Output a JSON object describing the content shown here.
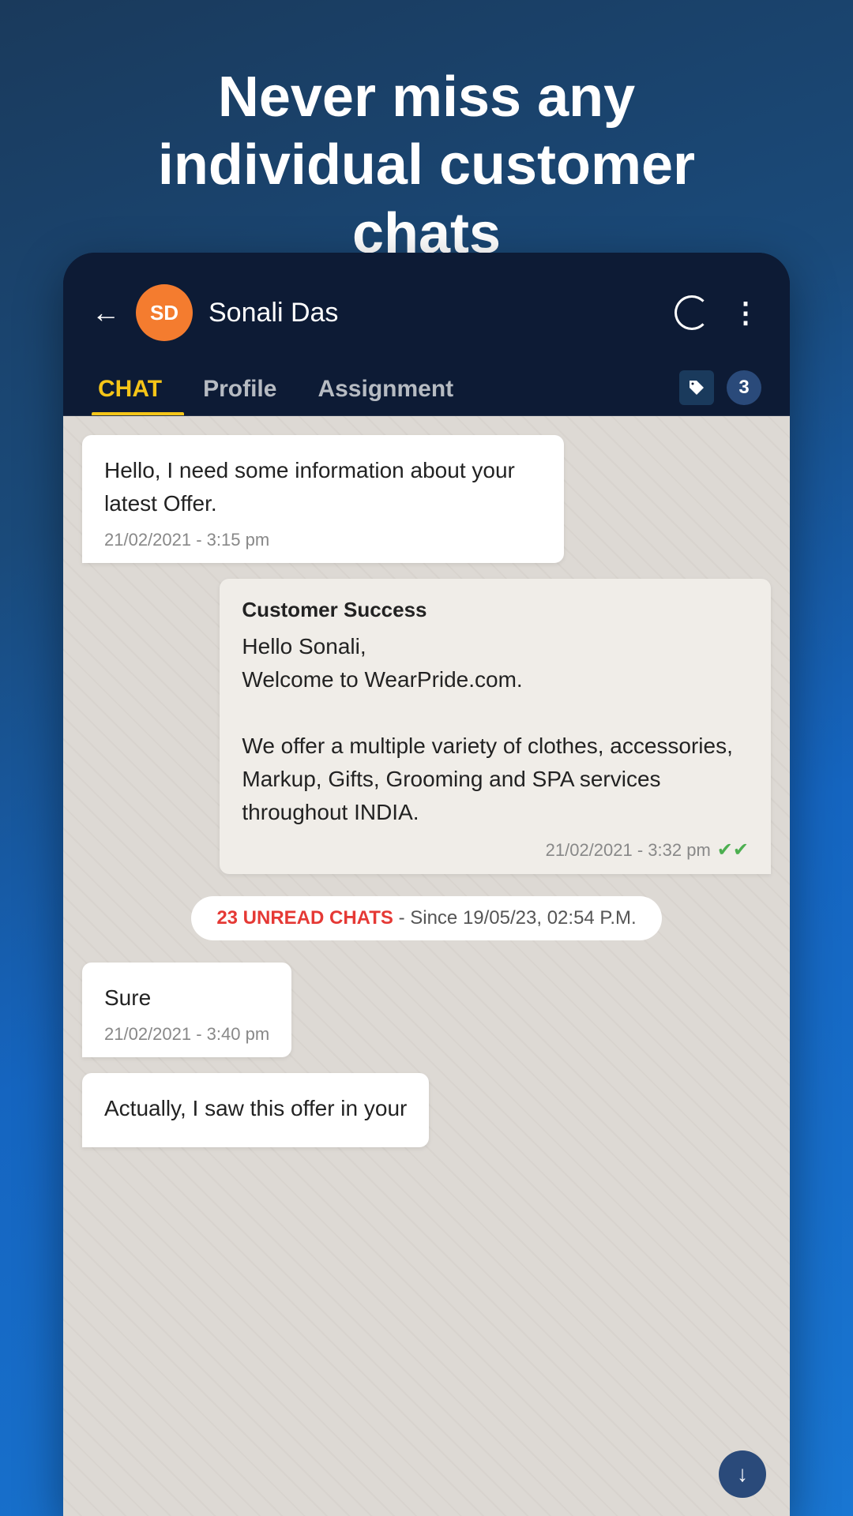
{
  "hero": {
    "line1": "Never miss any",
    "line2": "individual customer",
    "line3": "chats"
  },
  "header": {
    "avatar_initials": "SD",
    "contact_name": "Sonali Das",
    "back_label": "←"
  },
  "tabs": {
    "chat_label": "CHAT",
    "profile_label": "Profile",
    "assignment_label": "Assignment",
    "badge_count": "3"
  },
  "messages": [
    {
      "type": "incoming",
      "text": "Hello, I need some information about your latest Offer.",
      "time": "21/02/2021 - 3:15 pm"
    },
    {
      "type": "outgoing",
      "sender": "Customer Success",
      "text": "Hello Sonali,\nWelcome to WearPride.com.\n\nWe offer a multiple variety of clothes, accessories, Markup, Gifts, Grooming and SPA services throughout INDIA.",
      "time": "21/02/2021 - 3:32 pm",
      "read": true
    }
  ],
  "unread_banner": {
    "count": "23 UNREAD CHATS",
    "suffix": "- Since 19/05/23, 02:54 P.M."
  },
  "bottom_messages": [
    {
      "type": "incoming",
      "text": "Sure",
      "time": "21/02/2021 - 3:40 pm"
    },
    {
      "type": "incoming",
      "text": "Actually, I saw this offer in your",
      "time": ""
    }
  ]
}
